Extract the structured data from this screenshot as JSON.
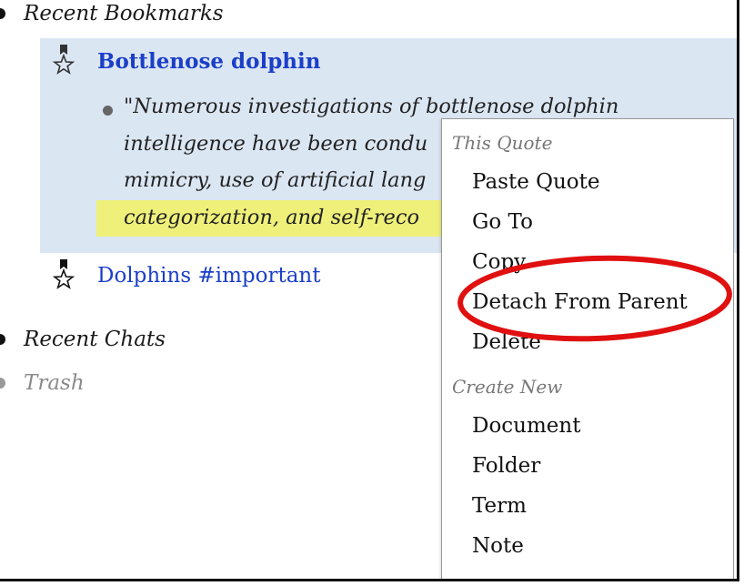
{
  "tree": {
    "recent_bookmarks_label": "Recent Bookmarks",
    "bookmarks": [
      {
        "label": "Bottlenose dolphin",
        "selected": true,
        "icon": "bookmark-star-icon"
      },
      {
        "label": "Dolphins #important",
        "selected": false,
        "icon": "bookmark-star-icon"
      }
    ],
    "quote_lines": [
      "\"Numerous investigations of bottlenose dolphin",
      "intelligence have been condu",
      "mimicry, use of artificial lang",
      "categorization, and self-reco"
    ],
    "recent_chats_label": "Recent Chats",
    "trash_label": "Trash"
  },
  "context_menu": {
    "section_this_quote": "This Quote",
    "items_this_quote": [
      "Paste Quote",
      "Go To",
      "Copy",
      "Detach From Parent",
      "Delete"
    ],
    "section_create_new": "Create New",
    "items_create_new": [
      "Document",
      "Folder",
      "Term",
      "Note"
    ]
  },
  "colors": {
    "selection_bg": "#dbe6f3",
    "highlight": "#eef07a",
    "link_blue": "#1b3fc7",
    "annotation_red": "#e01010"
  }
}
